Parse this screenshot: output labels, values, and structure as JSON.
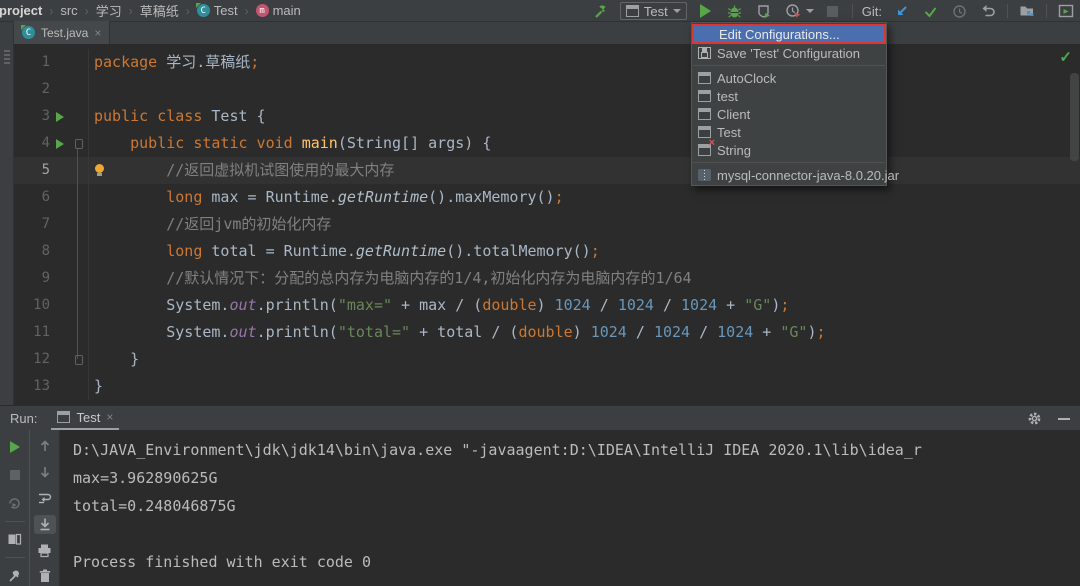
{
  "accent_colors": {
    "selection_blue": "#4b6eaf",
    "annotation_red": "#dd3434",
    "run_green": "#57a64a",
    "keyword_orange": "#cc7832",
    "string_green": "#6a8759",
    "number_blue": "#6897bb"
  },
  "breadcrumb": {
    "items": [
      {
        "label": "project",
        "bold": true,
        "icon": null
      },
      {
        "label": "src",
        "icon": null
      },
      {
        "label": "学习",
        "icon": null
      },
      {
        "label": "草稿纸",
        "icon": null
      },
      {
        "label": "Test",
        "icon": "class"
      },
      {
        "label": "main",
        "icon": "method"
      }
    ]
  },
  "toolbar": {
    "run_config_label": "Test",
    "git_label": "Git:"
  },
  "run_config_menu": {
    "items": [
      {
        "label": "Edit Configurations...",
        "icon": null,
        "selected": true,
        "annotated": true
      },
      {
        "label": "Save 'Test' Configuration",
        "icon": "save"
      },
      {
        "separator": true
      },
      {
        "label": "AutoClock",
        "icon": "app"
      },
      {
        "label": "test",
        "icon": "app"
      },
      {
        "label": "Client",
        "icon": "app"
      },
      {
        "label": "Test",
        "icon": "app"
      },
      {
        "label": "String",
        "icon": "app-error"
      },
      {
        "separator": true
      },
      {
        "label": "mysql-connector-java-8.0.20.jar",
        "icon": "jar"
      }
    ]
  },
  "editor": {
    "tab_label": "Test.java",
    "tab_close": "×",
    "check_mark": "✓",
    "current_line": 5,
    "lines": [
      {
        "n": 1,
        "tokens": [
          {
            "t": "package ",
            "c": "k"
          },
          {
            "t": "学习.草稿纸",
            "c": "d"
          },
          {
            "t": ";",
            "c": "k"
          }
        ]
      },
      {
        "n": 2,
        "tokens": []
      },
      {
        "n": 3,
        "run": true,
        "tokens": [
          {
            "t": "public class ",
            "c": "k"
          },
          {
            "t": "Test {",
            "c": "d"
          }
        ]
      },
      {
        "n": 4,
        "run": true,
        "fold": "open",
        "tokens": [
          {
            "t": "    ",
            "c": "d"
          },
          {
            "t": "public static void ",
            "c": "k"
          },
          {
            "t": "main",
            "c": "m"
          },
          {
            "t": "(String[] args) {",
            "c": "d"
          }
        ]
      },
      {
        "n": 5,
        "bulb": true,
        "tokens": [
          {
            "t": "        ",
            "c": "d"
          },
          {
            "t": "//返回虚拟机试图使用的最大内存",
            "c": "c"
          }
        ]
      },
      {
        "n": 6,
        "tokens": [
          {
            "t": "        ",
            "c": "d"
          },
          {
            "t": "long ",
            "c": "k"
          },
          {
            "t": "max = Runtime.",
            "c": "d"
          },
          {
            "t": "getRuntime",
            "c": "i"
          },
          {
            "t": "().maxMemory()",
            "c": "d"
          },
          {
            "t": ";",
            "c": "k"
          }
        ]
      },
      {
        "n": 7,
        "tokens": [
          {
            "t": "        ",
            "c": "d"
          },
          {
            "t": "//返回jvm的初始化内存",
            "c": "c"
          }
        ]
      },
      {
        "n": 8,
        "tokens": [
          {
            "t": "        ",
            "c": "d"
          },
          {
            "t": "long ",
            "c": "k"
          },
          {
            "t": "total = Runtime.",
            "c": "d"
          },
          {
            "t": "getRuntime",
            "c": "i"
          },
          {
            "t": "().totalMemory()",
            "c": "d"
          },
          {
            "t": ";",
            "c": "k"
          }
        ]
      },
      {
        "n": 9,
        "tokens": [
          {
            "t": "        ",
            "c": "d"
          },
          {
            "t": "//默认情况下：分配的总内存为电脑内存的1/4,初始化内存为电脑内存的1/64",
            "c": "c"
          }
        ]
      },
      {
        "n": 10,
        "tokens": [
          {
            "t": "        System.",
            "c": "d"
          },
          {
            "t": "out",
            "c": "f"
          },
          {
            "t": ".println(",
            "c": "d"
          },
          {
            "t": "\"max=\"",
            "c": "s"
          },
          {
            "t": " + max / (",
            "c": "d"
          },
          {
            "t": "double",
            "c": "k"
          },
          {
            "t": ") ",
            "c": "d"
          },
          {
            "t": "1024",
            "c": "n"
          },
          {
            "t": " / ",
            "c": "d"
          },
          {
            "t": "1024",
            "c": "n"
          },
          {
            "t": " / ",
            "c": "d"
          },
          {
            "t": "1024",
            "c": "n"
          },
          {
            "t": " + ",
            "c": "d"
          },
          {
            "t": "\"G\"",
            "c": "s"
          },
          {
            "t": ")",
            "c": "d"
          },
          {
            "t": ";",
            "c": "k"
          }
        ]
      },
      {
        "n": 11,
        "tokens": [
          {
            "t": "        System.",
            "c": "d"
          },
          {
            "t": "out",
            "c": "f"
          },
          {
            "t": ".println(",
            "c": "d"
          },
          {
            "t": "\"total=\"",
            "c": "s"
          },
          {
            "t": " + total / (",
            "c": "d"
          },
          {
            "t": "double",
            "c": "k"
          },
          {
            "t": ") ",
            "c": "d"
          },
          {
            "t": "1024",
            "c": "n"
          },
          {
            "t": " / ",
            "c": "d"
          },
          {
            "t": "1024",
            "c": "n"
          },
          {
            "t": " / ",
            "c": "d"
          },
          {
            "t": "1024",
            "c": "n"
          },
          {
            "t": " + ",
            "c": "d"
          },
          {
            "t": "\"G\"",
            "c": "s"
          },
          {
            "t": ")",
            "c": "d"
          },
          {
            "t": ";",
            "c": "k"
          }
        ]
      },
      {
        "n": 12,
        "fold": "close",
        "tokens": [
          {
            "t": "    }",
            "c": "d"
          }
        ]
      },
      {
        "n": 13,
        "tokens": [
          {
            "t": "}",
            "c": "d"
          }
        ]
      }
    ]
  },
  "run_panel": {
    "label": "Run:",
    "tab_label": "Test",
    "tab_close": "×",
    "console_lines": [
      "D:\\JAVA_Environment\\jdk\\jdk14\\bin\\java.exe \"-javaagent:D:\\IDEA\\IntelliJ IDEA 2020.1\\lib\\idea_r",
      "max=3.962890625G",
      "total=0.248046875G",
      "",
      "Process finished with exit code 0"
    ]
  }
}
